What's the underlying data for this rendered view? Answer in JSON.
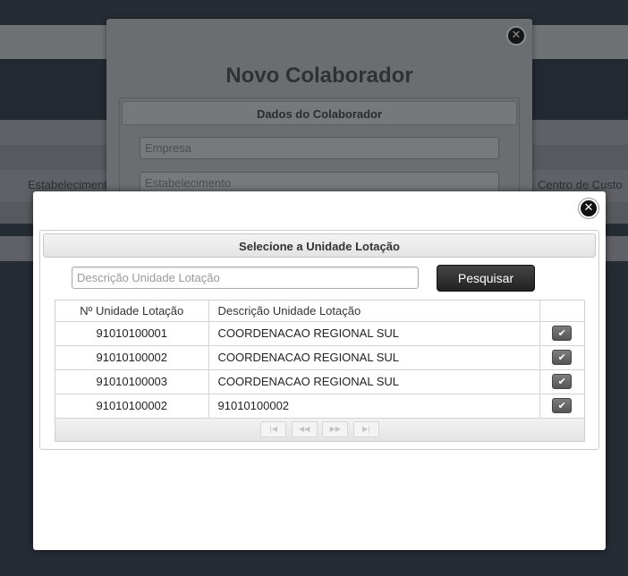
{
  "background": {
    "left_label": "Estabelecimento",
    "right_label": "Centro de Custo"
  },
  "modal_colaborador": {
    "title": "Novo Colaborador",
    "section_title": "Dados do Colaborador",
    "empresa_placeholder": "Empresa",
    "estabelecimento_placeholder": "Estabelecimento",
    "close_glyph": "✕"
  },
  "modal_unidade": {
    "close_glyph": "✕",
    "section_title": "Selecione a Unidade Lotação",
    "search": {
      "placeholder": "Descrição Unidade Lotação",
      "value": "",
      "button_label": "Pesquisar"
    },
    "table": {
      "headers": [
        "Nº Unidade Lotação",
        "Descrição Unidade Lotação",
        ""
      ],
      "rows": [
        {
          "numero": "91010100001",
          "descricao": "COORDENACAO REGIONAL SUL"
        },
        {
          "numero": "91010100002",
          "descricao": "COORDENACAO REGIONAL SUL"
        },
        {
          "numero": "91010100003",
          "descricao": "COORDENACAO REGIONAL SUL"
        },
        {
          "numero": "91010100002",
          "descricao": "91010100002"
        }
      ],
      "select_glyph": "✔"
    },
    "pager": {
      "first": "|◀",
      "prev": "◀◀",
      "next": "▶▶",
      "last": "▶|"
    }
  }
}
